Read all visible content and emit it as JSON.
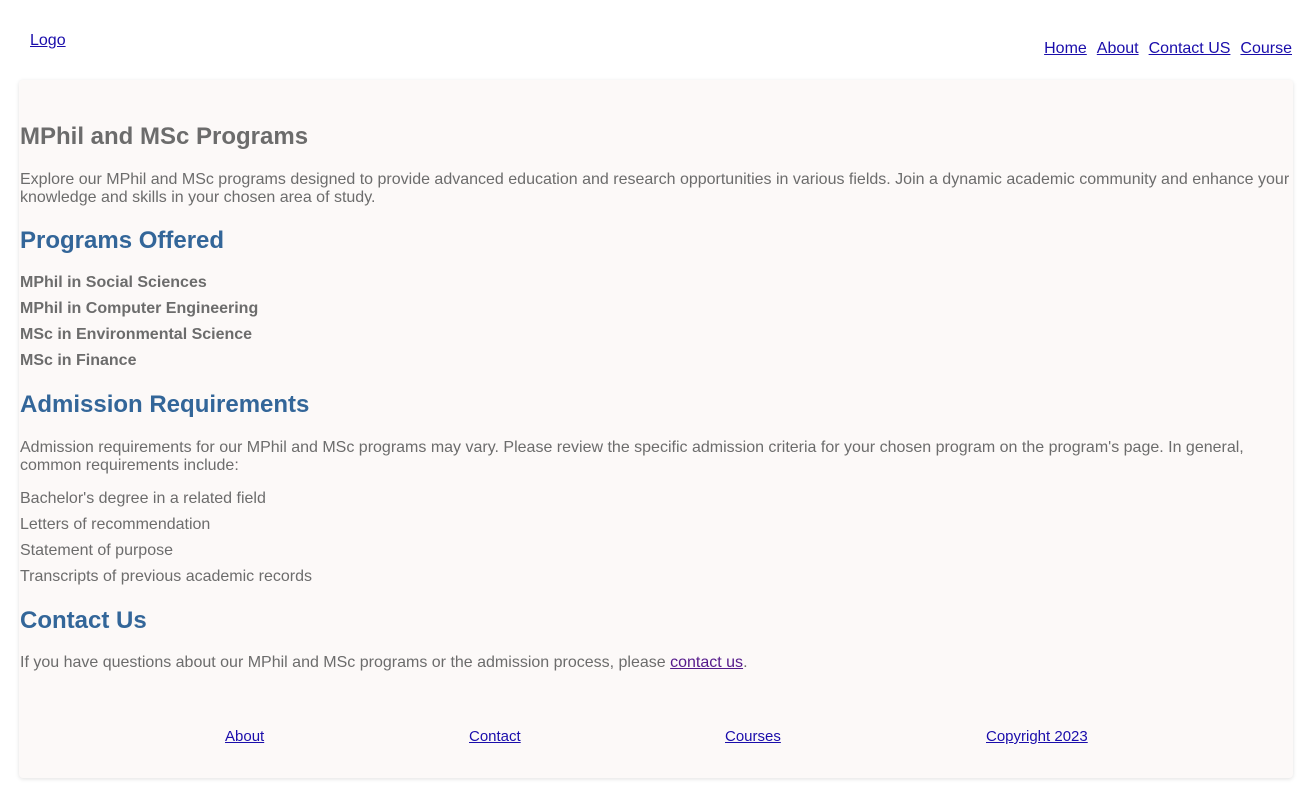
{
  "header": {
    "logo": "Logo",
    "nav": [
      "Home",
      "About",
      "Contact US",
      "Course"
    ]
  },
  "main": {
    "title": "MPhil and MSc Programs",
    "intro": "Explore our MPhil and MSc programs designed to provide advanced education and research opportunities in various fields. Join a dynamic academic community and enhance your knowledge and skills in your chosen area of study.",
    "programs_heading": "Programs Offered",
    "programs": [
      "MPhil in Social Sciences",
      "MPhil in Computer Engineering",
      "MSc in Environmental Science",
      "MSc in Finance"
    ],
    "admission_heading": "Admission Requirements",
    "admission_text": "Admission requirements for our MPhil and MSc programs may vary. Please review the specific admission criteria for your chosen program on the program's page. In general, common requirements include:",
    "requirements": [
      "Bachelor's degree in a related field",
      "Letters of recommendation",
      "Statement of purpose",
      "Transcripts of previous academic records"
    ],
    "contact_heading": "Contact Us",
    "contact_text_before": "If you have questions about our MPhil and MSc programs or the admission process, please ",
    "contact_link": "contact us",
    "contact_text_after": "."
  },
  "footer": {
    "about": "About",
    "contact": "Contact",
    "courses": "Courses",
    "copyright": "Copyright 2023"
  }
}
